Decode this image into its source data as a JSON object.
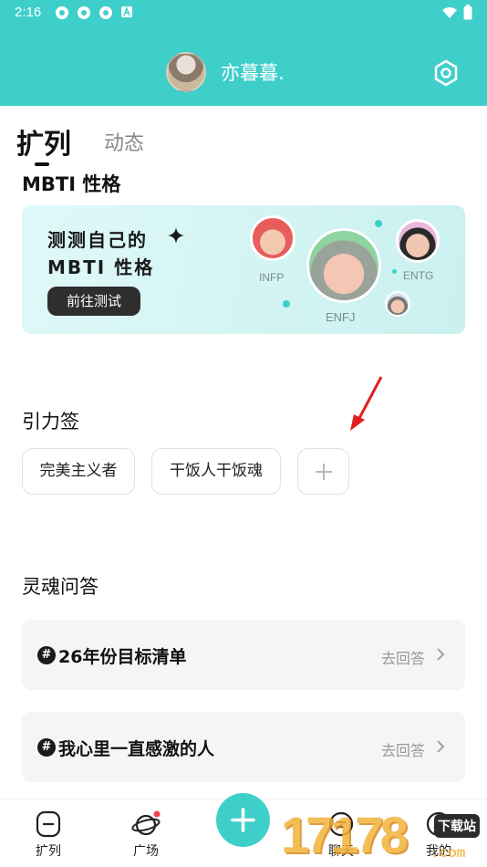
{
  "status_bar": {
    "time": "2:16"
  },
  "profile": {
    "name": "亦暮暮."
  },
  "tabs": {
    "active": "扩列",
    "inactive": "动态"
  },
  "mbti": {
    "section_title": "MBTI 性格",
    "card_title_line1": "测测自己的",
    "card_title_line2": "MBTI 性格",
    "button": "前往测试",
    "types": [
      "INFP",
      "ENFJ",
      "ENTG"
    ]
  },
  "tags": {
    "section_title": "引力签",
    "items": [
      "完美主义者",
      "干饭人干饭魂"
    ]
  },
  "qa": {
    "section_title": "灵魂问答",
    "items": [
      {
        "text": "26年份目标清单",
        "action": "去回答"
      },
      {
        "text": "我心里一直感激的人",
        "action": "去回答"
      }
    ]
  },
  "nav": {
    "items": [
      {
        "label": "扩列",
        "icon": "expand-list-icon"
      },
      {
        "label": "广场",
        "icon": "planet-icon"
      },
      {
        "label": "聊天",
        "icon": "chat-icon"
      },
      {
        "label": "我的",
        "icon": "profile-icon"
      }
    ]
  },
  "watermark": {
    "text": "17178",
    "badge": "下载站",
    "suffix": ".com"
  },
  "colors": {
    "accent": "#3fcfca",
    "card_bg": "#dff8f8",
    "qa_bg": "#f4f5f6",
    "arrow": "#e02020"
  }
}
